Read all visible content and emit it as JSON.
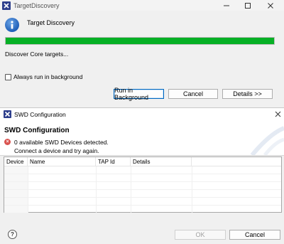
{
  "discovery": {
    "title": "TargetDiscovery",
    "heading": "Target Discovery",
    "progress_fraction": 1.0,
    "status": "Discover Core targets...",
    "checkbox_label": "Always run in background",
    "checkbox_checked": false,
    "buttons": {
      "background": "Run in Background",
      "cancel": "Cancel",
      "details": "Details >>"
    }
  },
  "swd": {
    "title": "SWD Configuration",
    "heading": "SWD Configuration",
    "error_line1": "0 available SWD Devices detected.",
    "error_line2": "Connect a device and try again.",
    "table": {
      "columns": [
        "Device",
        "Name",
        "TAP Id",
        "Details"
      ],
      "rows": []
    },
    "buttons": {
      "ok": "OK",
      "cancel": "Cancel"
    }
  },
  "icons": {
    "app": "eclipse-x-icon",
    "info": "info-icon",
    "error": "error-icon",
    "help": "help-icon",
    "minimize": "minimize-icon",
    "maximize": "maximize-icon",
    "close": "close-icon"
  },
  "colors": {
    "progress": "#06b025",
    "accent": "#0067c0",
    "error": "#d9534f"
  }
}
